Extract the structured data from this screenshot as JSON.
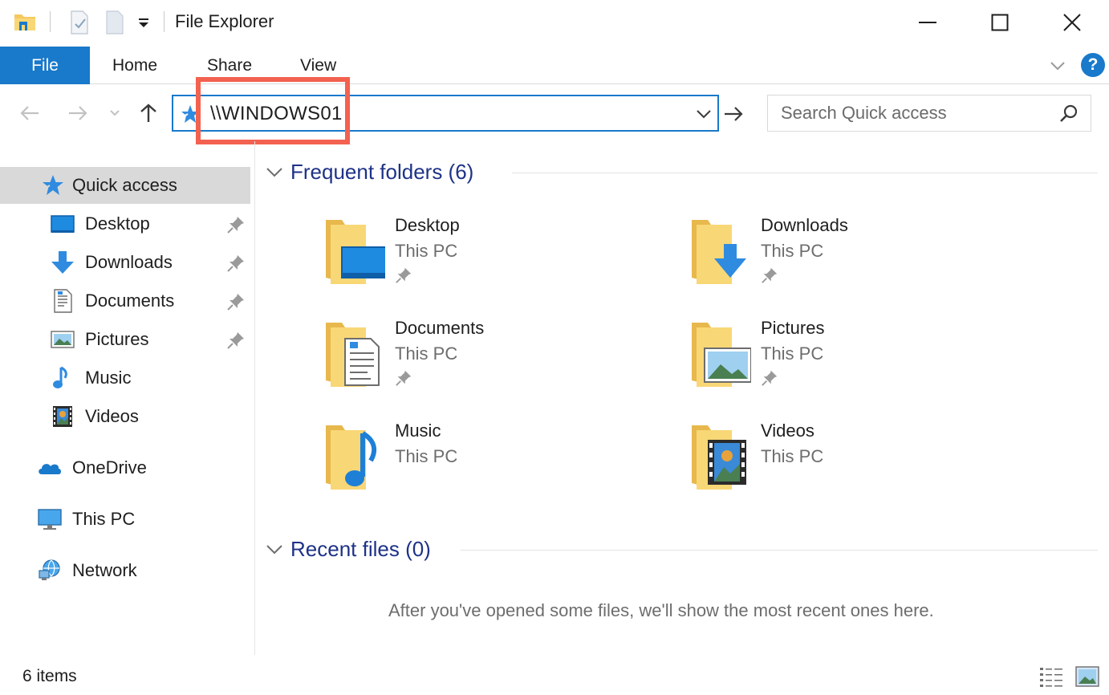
{
  "window": {
    "title": "File Explorer"
  },
  "ribbon": {
    "tabs": [
      {
        "label": "File"
      },
      {
        "label": "Home"
      },
      {
        "label": "Share"
      },
      {
        "label": "View"
      }
    ],
    "help_label": "?"
  },
  "address_bar": {
    "value": "\\\\WINDOWS01",
    "icon": "quick-access-star-icon"
  },
  "search": {
    "placeholder": "Search Quick access"
  },
  "nav_pane": {
    "items": [
      {
        "label": "Quick access",
        "icon": "star-icon",
        "selected": true
      },
      {
        "label": "Desktop",
        "icon": "desktop-icon",
        "pinned": true
      },
      {
        "label": "Downloads",
        "icon": "download-arrow-icon",
        "pinned": true
      },
      {
        "label": "Documents",
        "icon": "document-icon",
        "pinned": true
      },
      {
        "label": "Pictures",
        "icon": "picture-icon",
        "pinned": true
      },
      {
        "label": "Music",
        "icon": "music-note-icon"
      },
      {
        "label": "Videos",
        "icon": "film-strip-icon"
      },
      {
        "label": "OneDrive",
        "icon": "cloud-icon"
      },
      {
        "label": "This PC",
        "icon": "monitor-icon"
      },
      {
        "label": "Network",
        "icon": "network-globe-icon"
      }
    ]
  },
  "frequent_folders": {
    "header": "Frequent folders (6)",
    "folders": [
      {
        "name": "Desktop",
        "location": "This PC",
        "pinned": true
      },
      {
        "name": "Downloads",
        "location": "This PC",
        "pinned": true
      },
      {
        "name": "Documents",
        "location": "This PC",
        "pinned": true
      },
      {
        "name": "Pictures",
        "location": "This PC",
        "pinned": true
      },
      {
        "name": "Music",
        "location": "This PC",
        "pinned": false
      },
      {
        "name": "Videos",
        "location": "This PC",
        "pinned": false
      }
    ]
  },
  "recent_files": {
    "header": "Recent files (0)",
    "empty_message": "After you've opened some files, we'll show the most recent ones here."
  },
  "status_bar": {
    "item_count": "6 items"
  },
  "colors": {
    "accent": "#1979ca",
    "header_text": "#1e3287",
    "highlight": "#f3614f",
    "folder": "#f5c85f"
  }
}
